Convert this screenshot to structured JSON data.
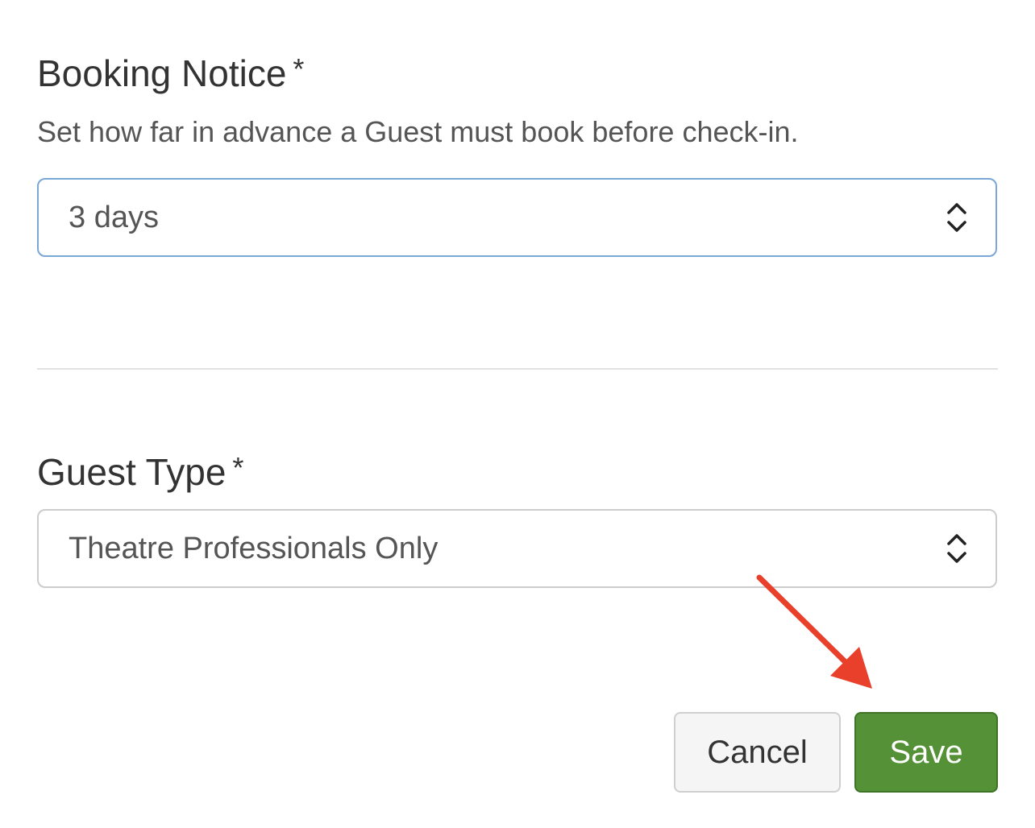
{
  "booking_notice": {
    "title": "Booking Notice",
    "required_mark": "*",
    "help_text": "Set how far in advance a Guest must book before check-in.",
    "selected_value": "3 days"
  },
  "guest_type": {
    "title": "Guest Type",
    "required_mark": "*",
    "selected_value": "Theatre Professionals Only"
  },
  "actions": {
    "cancel_label": "Cancel",
    "save_label": "Save"
  },
  "colors": {
    "save_button": "#559136",
    "focus_border": "#7aa7d6",
    "annotation_arrow": "#e8402b"
  },
  "icons": {
    "select_indicator": "chevron-up-down-icon",
    "annotation": "arrow-pointer-icon"
  }
}
